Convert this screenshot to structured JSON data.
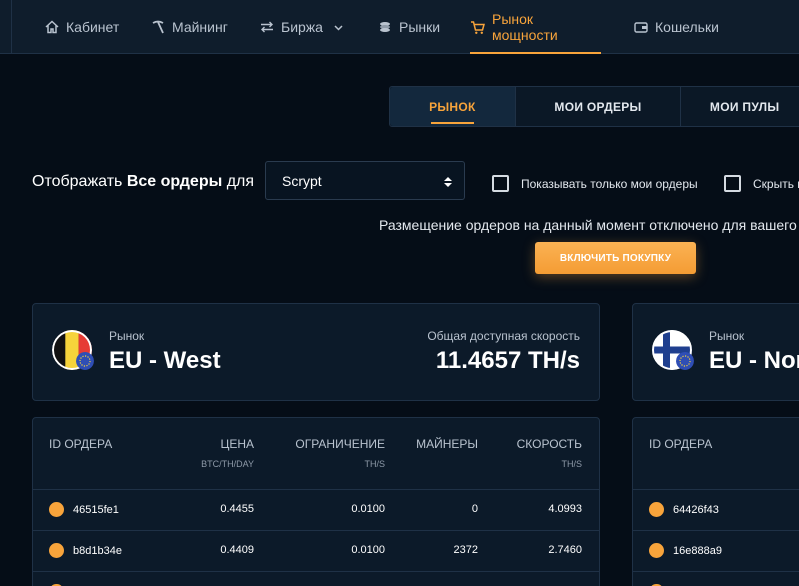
{
  "nav": {
    "items": [
      {
        "label": "Кабинет",
        "icon": "home-icon"
      },
      {
        "label": "Майнинг",
        "icon": "pickaxe-icon"
      },
      {
        "label": "Биржа",
        "icon": "exchange-icon"
      },
      {
        "label": "Рынки",
        "icon": "coins-icon"
      },
      {
        "label": "Рынок мощности",
        "icon": "cart-icon"
      },
      {
        "label": "Кошельки",
        "icon": "wallet-icon"
      }
    ],
    "active": "Рынок мощности"
  },
  "tabs": [
    "РЫНОК",
    "МОИ ОРДЕРЫ",
    "МОИ ПУЛЫ"
  ],
  "filter": {
    "prefix": "Отображать",
    "bold": "Все ордеры",
    "suffix": "для",
    "algorithm": "Scrypt",
    "show_only_mine": "Показывать только мои ордеры",
    "hide_label": "Скрыть н"
  },
  "notice": "Размещение ордеров на данный момент отключено для вашего а",
  "enable_button": "ВКЛЮЧИТЬ ПОКУПКУ",
  "colors": {
    "accent": "#f8a43b",
    "background": "#050d17",
    "card": "#0c1a29"
  },
  "markets": [
    {
      "market_label": "Рынок",
      "name": "EU - West",
      "flag": "belgium-flag-icon",
      "speed_label": "Общая доступная скорость",
      "speed": "11.4657 TH/s",
      "columns": [
        {
          "label": "ID ОРДЕРА",
          "unit": ""
        },
        {
          "label": "ЦЕНА",
          "unit": "BTC/TH/DAY"
        },
        {
          "label": "ОГРАНИЧЕНИЕ",
          "unit": "TH/S"
        },
        {
          "label": "МАЙНЕРЫ",
          "unit": ""
        },
        {
          "label": "СКОРОСТЬ",
          "unit": "TH/S"
        }
      ],
      "rows": [
        {
          "id": "46515fe1",
          "price": "0.4455",
          "limit": "0.0100",
          "miners": "0",
          "speed": "4.0993"
        },
        {
          "id": "b8d1b34e",
          "price": "0.4409",
          "limit": "0.0100",
          "miners": "2372",
          "speed": "2.7460"
        }
      ]
    },
    {
      "market_label": "Рынок",
      "name": "EU - Nor",
      "flag": "finland-flag-icon",
      "columns": [
        {
          "label": "ID ОРДЕРА",
          "unit": ""
        }
      ],
      "rows": [
        {
          "id": "64426f43"
        },
        {
          "id": "16e888a9"
        }
      ]
    }
  ]
}
